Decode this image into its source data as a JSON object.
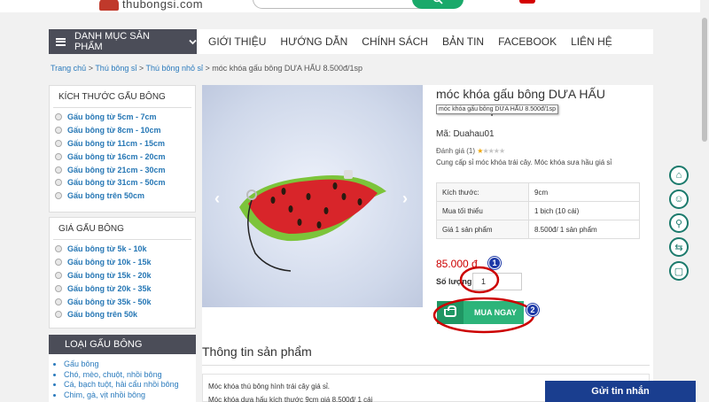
{
  "header": {
    "logo_text": "thubongsi.com"
  },
  "nav": {
    "category_menu": "DANH MỤC SẢN PHẨM",
    "items": [
      "GIỚI THIỆU",
      "HƯỚNG DẪN",
      "CHÍNH SÁCH",
      "BẢN TIN",
      "FACEBOOK",
      "LIÊN HỆ"
    ]
  },
  "breadcrumb": {
    "items": [
      "Trang chủ",
      "Thú bông sỉ",
      "Thú bông nhỏ sỉ"
    ],
    "separator": " > ",
    "current": "móc khóa gấu bông DƯA HẤU 8.500đ/1sp"
  },
  "sidebar": {
    "size_title": "KÍCH THƯỚC GẤU BÔNG",
    "size_options": [
      "Gấu bông từ 5cm - 7cm",
      "Gấu bông từ 8cm - 10cm",
      "Gấu bông từ 11cm - 15cm",
      "Gấu bông từ 16cm - 20cm",
      "Gấu bông từ 21cm - 30cm",
      "Gấu bông từ 31cm - 50cm",
      "Gấu bông trên 50cm"
    ],
    "price_title": "GIÁ GẤU BÔNG",
    "price_options": [
      "Gấu bông từ 5k - 10k",
      "Gấu bông từ 10k - 15k",
      "Gấu bông từ 15k - 20k",
      "Gấu bông từ 20k - 35k",
      "Gấu bông từ 35k - 50k",
      "Gấu bông trên 50k"
    ],
    "type_title": "LOẠI GẤU BÔNG",
    "type_items": [
      "Gấu bông",
      "Chó, mèo, chuột, nhồi bông",
      "Cá, bạch tuột, hải cẩu nhồi bông",
      "Chim, gà, vịt nhồi bông"
    ]
  },
  "product": {
    "title": "móc khóa gấu bông DƯA HẤU 8.500đ/1sp",
    "tooltip": "móc khóa gấu bông DƯA HẤU 8.500đ/1sp",
    "code_label": "Mã:",
    "code": "Duahau01",
    "rating_label": "Đánh giá (1)",
    "rating_value": 1,
    "rating_max": 5,
    "short_desc": "Cung cấp sỉ móc khóa trái cây. Móc khóa sưa hầu giá sỉ",
    "specs": [
      {
        "label": "Kích thước:",
        "value": "9cm"
      },
      {
        "label": "Mua tối thiểu",
        "value": "1 bịch (10 cái)"
      },
      {
        "label": "Giá 1 sản phẩm",
        "value": "8.500đ/ 1 sản phẩm"
      }
    ],
    "price": "85.000 đ",
    "qty_label": "Số lượng:",
    "qty_value": "1",
    "buy_label": "MUA NGAY",
    "info_title": "Thông tin sản phẩm",
    "description": [
      "Móc khóa thú bông hình trái cây giá sỉ.",
      "Móc khóa dưa hấu kích thước 9cm giá 8.500đ/ 1 cái"
    ]
  },
  "annotations": {
    "marker_1": "1",
    "marker_2": "2"
  },
  "slider": {
    "prev": "‹",
    "next": "›"
  },
  "right_icons": [
    "home-icon",
    "support-icon",
    "search-icon",
    "transfer-icon",
    "chat-icon"
  ],
  "chat": {
    "label": "Gửi tin nhắn"
  },
  "colors": {
    "nav_dark": "#4b4d58",
    "buy_green": "#2db47a",
    "price_red": "#cc0000",
    "link_blue": "#2677b5",
    "annotation_red": "#cc0000",
    "marker_blue": "#1e3aa8",
    "chat_blue": "#1a3e8f"
  }
}
